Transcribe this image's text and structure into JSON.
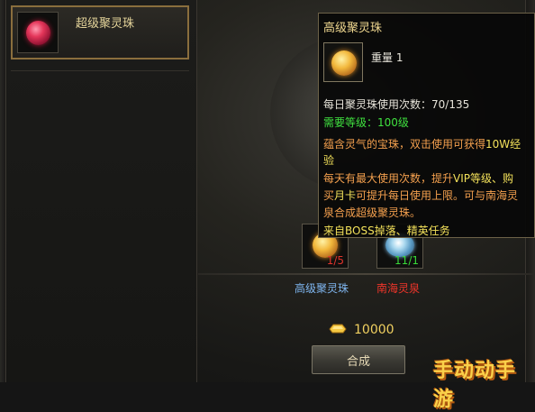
{
  "list": {
    "items": [
      {
        "name": "超级聚灵珠",
        "icon": "red-orb-icon"
      }
    ]
  },
  "tooltip": {
    "title": "高级聚灵珠",
    "weight": "重量 1",
    "daily_usage": "每日聚灵珠使用次数：70/135",
    "level_req": "需要等级：100级",
    "desc1_a": "蕴含灵气的宝珠，双击使用可获得",
    "desc1_b": "10W经",
    "desc1_c": "验",
    "desc2_a": "每天有最大使用次数，提升",
    "desc2_b": "VIP等级、购",
    "desc2_c": "买",
    "desc2_d": "月卡",
    "desc2_e": "可提升每日使用上限。可与南海灵",
    "desc2_f": "泉合成超级聚灵珠。",
    "source": "来自BOSS掉落、精英任务"
  },
  "materials": [
    {
      "name": "高级聚灵珠",
      "count": "1/5",
      "icon": "gold-orb-icon",
      "name_color": "#7fb6f0",
      "count_color": "#e0342c"
    },
    {
      "name": "南海灵泉",
      "count": "11/1",
      "icon": "spring-water-icon",
      "name_color": "#f0352a",
      "count_color": "#38d838"
    }
  ],
  "cost": {
    "amount": "10000",
    "icon": "gold-ingot-icon"
  },
  "merge_button": {
    "label": "合成"
  },
  "watermark": "手动动手游"
}
